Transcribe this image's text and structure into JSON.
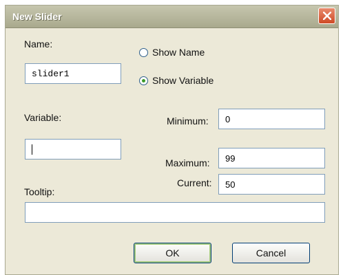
{
  "window": {
    "title": "New Slider"
  },
  "form": {
    "name_label": "Name:",
    "name_value": "slider1",
    "show_name_label": "Show Name",
    "show_variable_label": "Show Variable",
    "selected_option": "Show Variable",
    "variable_label": "Variable:",
    "variable_value": "",
    "minimum_label": "Minimum:",
    "minimum_value": "0",
    "maximum_label": "Maximum:",
    "maximum_value": "99",
    "current_label": "Current:",
    "current_value": "50",
    "tooltip_label": "Tooltip:",
    "tooltip_value": ""
  },
  "buttons": {
    "ok_label": "OK",
    "cancel_label": "Cancel"
  },
  "colors": {
    "close_button": "#d9582f",
    "dialog_background": "#ece9d8",
    "radio_selected": "#3b9b28"
  },
  "icons": {
    "close": "close-icon"
  }
}
